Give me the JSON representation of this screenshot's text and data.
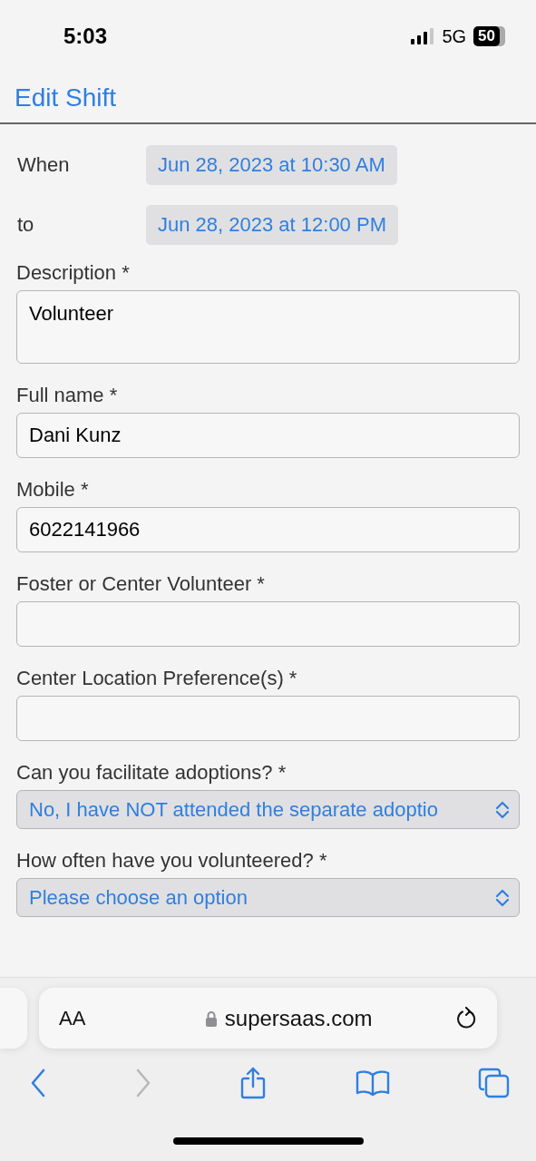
{
  "status_bar": {
    "time": "5:03",
    "network": "5G",
    "battery": "50"
  },
  "header": {
    "title": "Edit Shift"
  },
  "dates": [
    {
      "label": "When",
      "value": "Jun 28, 2023 at 10:30 AM"
    },
    {
      "label": "to",
      "value": "Jun 28, 2023 at 12:00 PM"
    }
  ],
  "fields": [
    {
      "kind": "textarea",
      "label": "Description *",
      "value": "Volunteer"
    },
    {
      "kind": "text",
      "label": "Full name *",
      "value": "Dani Kunz"
    },
    {
      "kind": "text",
      "label": "Mobile *",
      "value": "6022141966"
    },
    {
      "kind": "text",
      "label": "Foster or Center Volunteer *"
    },
    {
      "kind": "text",
      "label": "Center Location Preference(s) *"
    },
    {
      "kind": "select",
      "label": "Can you facilitate adoptions? *",
      "value": "No, I have NOT attended the separate adoptio"
    },
    {
      "kind": "select",
      "label": "How often have you volunteered? *",
      "value": "Please choose an option"
    }
  ],
  "browser": {
    "text_size": "AA",
    "url": "supersaas.com"
  },
  "toolbar": [
    {
      "kind": "back",
      "disabled": false
    },
    {
      "kind": "forward",
      "disabled": true
    },
    {
      "kind": "share",
      "disabled": false
    },
    {
      "kind": "bookmarks",
      "disabled": false
    },
    {
      "kind": "tabs",
      "disabled": false
    }
  ]
}
